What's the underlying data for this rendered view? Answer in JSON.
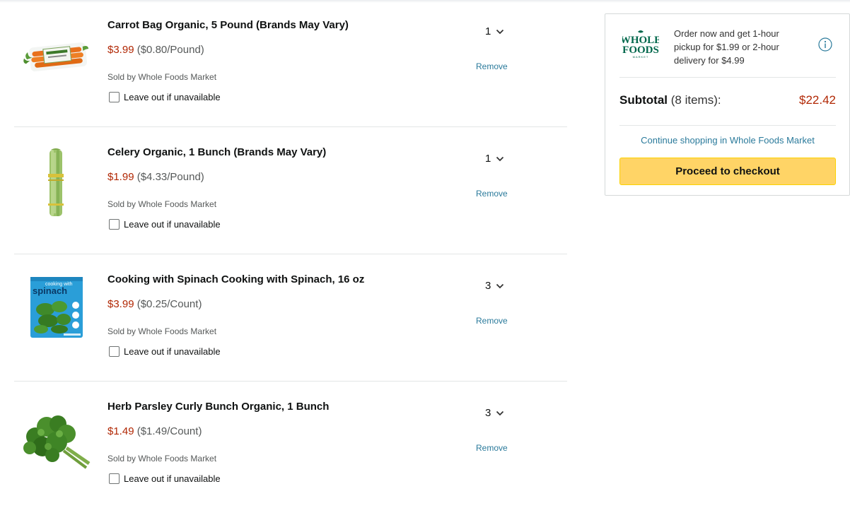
{
  "items": [
    {
      "title": "Carrot Bag Organic, 5 Pound (Brands May Vary)",
      "price": "$3.99",
      "unit_price": "($0.80/Pound)",
      "seller": "Sold by Whole Foods Market",
      "leave_out": "Leave out if unavailable",
      "qty": "1",
      "remove": "Remove",
      "image": "carrot-bag-image"
    },
    {
      "title": "Celery Organic, 1 Bunch (Brands May Vary)",
      "price": "$1.99",
      "unit_price": "($4.33/Pound)",
      "seller": "Sold by Whole Foods Market",
      "leave_out": "Leave out if unavailable",
      "qty": "1",
      "remove": "Remove",
      "image": "celery-image"
    },
    {
      "title": "Cooking with Spinach Cooking with Spinach, 16 oz",
      "price": "$3.99",
      "unit_price": "($0.25/Count)",
      "seller": "Sold by Whole Foods Market",
      "leave_out": "Leave out if unavailable",
      "qty": "3",
      "remove": "Remove",
      "image": "spinach-bag-image",
      "image_text": {
        "top": "cooking with",
        "main": "spinach"
      }
    },
    {
      "title": "Herb Parsley Curly Bunch Organic, 1 Bunch",
      "price": "$1.49",
      "unit_price": "($1.49/Count)",
      "seller": "Sold by Whole Foods Market",
      "leave_out": "Leave out if unavailable",
      "qty": "3",
      "remove": "Remove",
      "image": "parsley-image"
    }
  ],
  "summary": {
    "logo_line1": "WHOLE",
    "logo_line2": "FOODS",
    "logo_line3": "MARKET",
    "promo": "Order now and get 1-hour pickup for $1.99 or 2-hour delivery for $4.99",
    "subtotal_label": "Subtotal",
    "item_count": "(8 items):",
    "total": "$22.42",
    "continue_link": "Continue shopping in Whole Foods Market",
    "checkout_button": "Proceed to checkout"
  },
  "colors": {
    "price": "#b12704",
    "link": "#2a7a9b",
    "checkout": "#ffd466",
    "brand_green": "#00674b"
  }
}
